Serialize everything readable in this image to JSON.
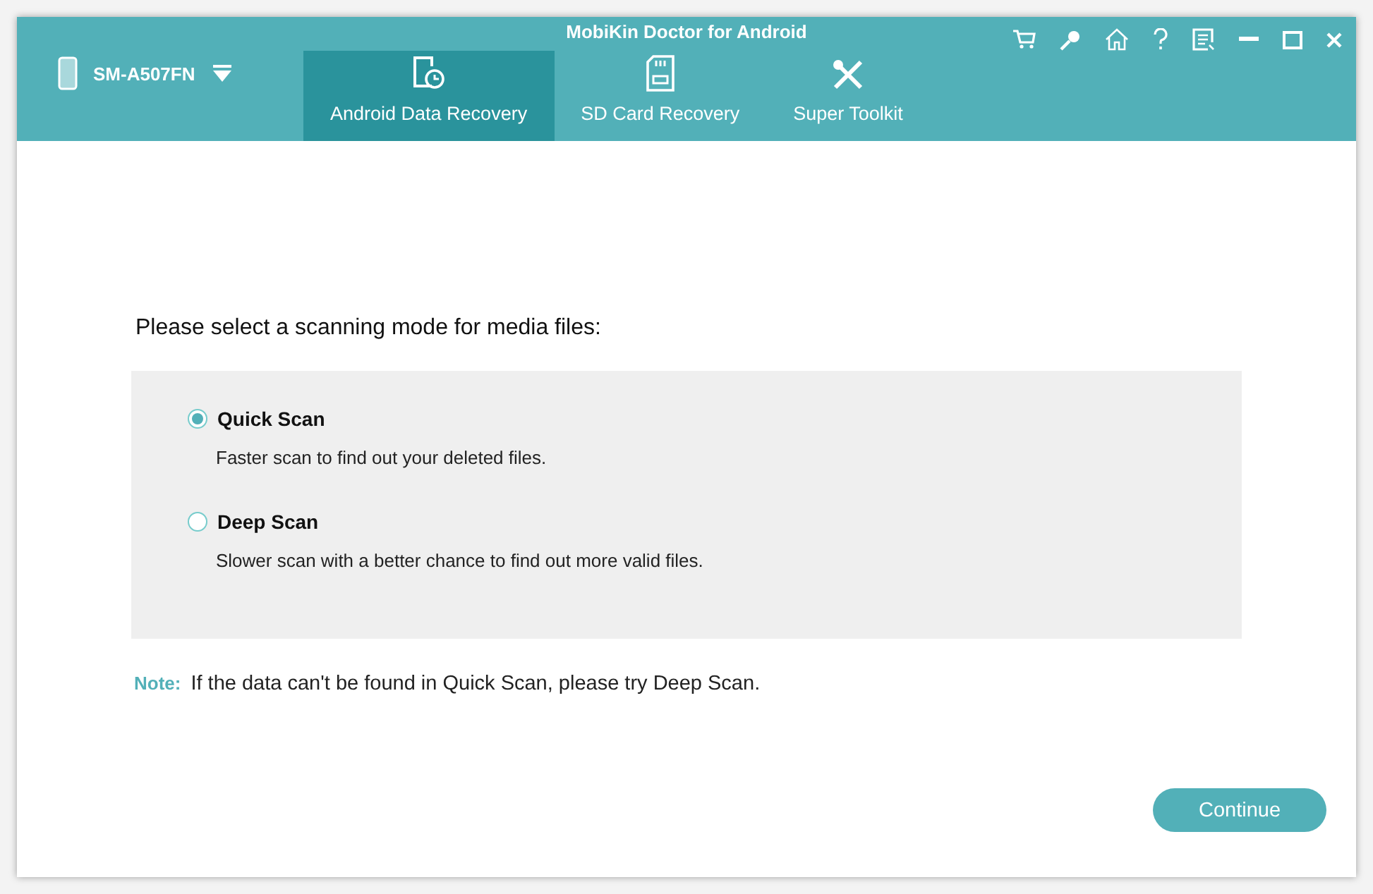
{
  "window": {
    "title": "MobiKin Doctor for Android"
  },
  "device": {
    "name": "SM-A507FN"
  },
  "tabs": [
    {
      "label": "Android Data Recovery",
      "kind": "phone-restore",
      "selected": true
    },
    {
      "label": "SD Card Recovery",
      "kind": "sd-card",
      "selected": false
    },
    {
      "label": "Super Toolkit",
      "kind": "tools",
      "selected": false
    }
  ],
  "prompt": "Please select a scanning mode for media files:",
  "modes": [
    {
      "label": "Quick Scan",
      "description": "Faster scan to find out your deleted files.",
      "selected": true
    },
    {
      "label": "Deep Scan",
      "description": "Slower scan with a better chance to find out more valid files.",
      "selected": false
    }
  ],
  "note": {
    "label": "Note:",
    "text": "If the data can't be found in Quick Scan, please try Deep Scan."
  },
  "continue_button": "Continue"
}
